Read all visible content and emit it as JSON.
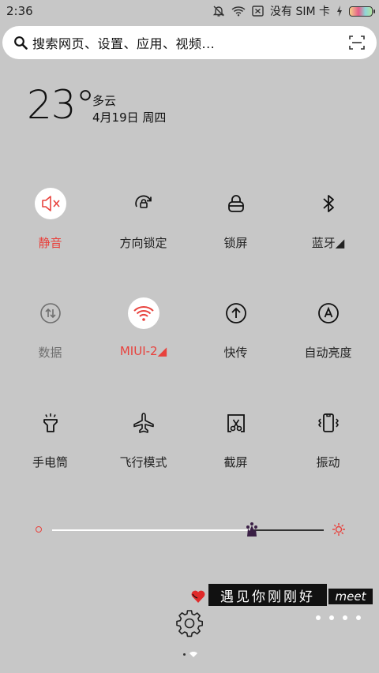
{
  "status_bar": {
    "time": "2:36",
    "sim_text": "没有 SIM 卡"
  },
  "search": {
    "placeholder": "搜索网页、设置、应用、视频..."
  },
  "weather": {
    "temperature": "23°",
    "condition": "多云",
    "date": "4月19日 周四"
  },
  "toggles": [
    {
      "label": "静音",
      "icon": "mute-icon",
      "active": true
    },
    {
      "label": "方向锁定",
      "icon": "rotation-lock-icon",
      "active": false
    },
    {
      "label": "锁屏",
      "icon": "lock-icon",
      "active": false
    },
    {
      "label": "蓝牙◢",
      "icon": "bluetooth-icon",
      "active": false
    },
    {
      "label": "数据",
      "icon": "mobile-data-icon",
      "active": false
    },
    {
      "label": "MIUI-2◢",
      "icon": "wifi-icon",
      "active": true
    },
    {
      "label": "快传",
      "icon": "quick-transfer-icon",
      "active": false
    },
    {
      "label": "自动亮度",
      "icon": "auto-brightness-icon",
      "active": false
    },
    {
      "label": "手电筒",
      "icon": "flashlight-icon",
      "active": false
    },
    {
      "label": "飞行模式",
      "icon": "airplane-icon",
      "active": false
    },
    {
      "label": "截屏",
      "icon": "screenshot-icon",
      "active": false
    },
    {
      "label": "振动",
      "icon": "vibrate-icon",
      "active": false
    }
  ],
  "brightness": {
    "level": 0.74
  },
  "bottom": {
    "tag_cn": "遇见你刚刚好",
    "tag_en": "meet",
    "page_dots": 4
  },
  "colors": {
    "active_red": "#e8423d",
    "background": "#c7c7c7"
  }
}
